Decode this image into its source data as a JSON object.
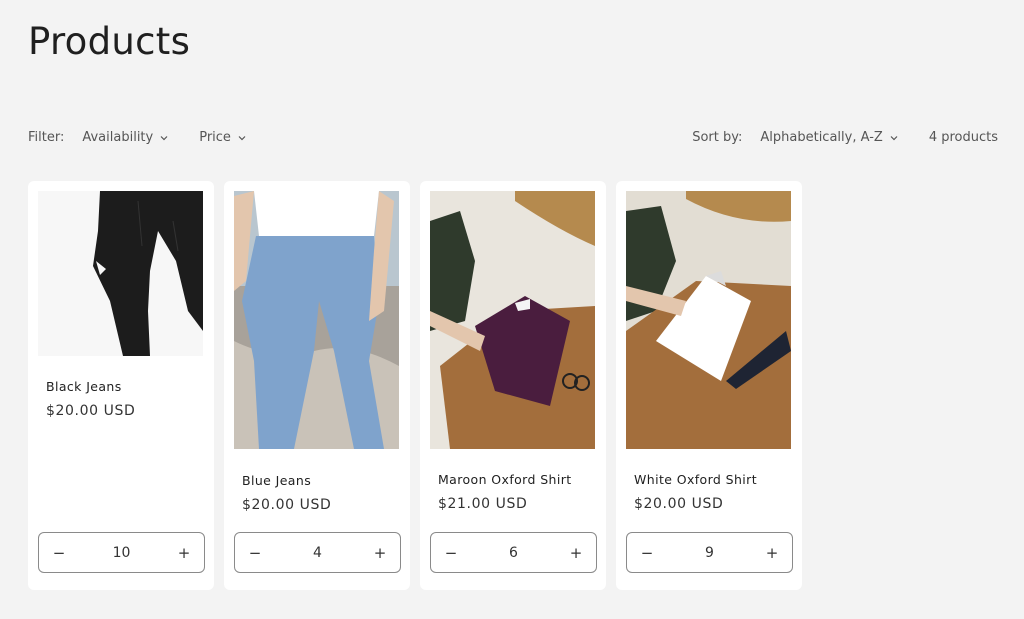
{
  "page": {
    "title": "Products"
  },
  "filters": {
    "label": "Filter:",
    "availability": "Availability",
    "price": "Price"
  },
  "sort": {
    "label": "Sort by:",
    "value": "Alphabetically, A-Z",
    "count": "4 products"
  },
  "products": [
    {
      "name": "Black Jeans",
      "price": "$20.00 USD",
      "quantity": "10",
      "minus": "−",
      "plus": "+"
    },
    {
      "name": "Blue Jeans",
      "price": "$20.00 USD",
      "quantity": "4",
      "minus": "−",
      "plus": "+"
    },
    {
      "name": "Maroon Oxford Shirt",
      "price": "$21.00 USD",
      "quantity": "6",
      "minus": "−",
      "plus": "+"
    },
    {
      "name": "White Oxford Shirt",
      "price": "$20.00 USD",
      "quantity": "9",
      "minus": "−",
      "plus": "+"
    }
  ],
  "colors": {
    "background": "#f3f3f3",
    "card": "#ffffff",
    "text": "#1f1f1f",
    "muted": "#555555",
    "maroon_shirt": "#4a1d3e",
    "denim": "#7fa3cc"
  }
}
